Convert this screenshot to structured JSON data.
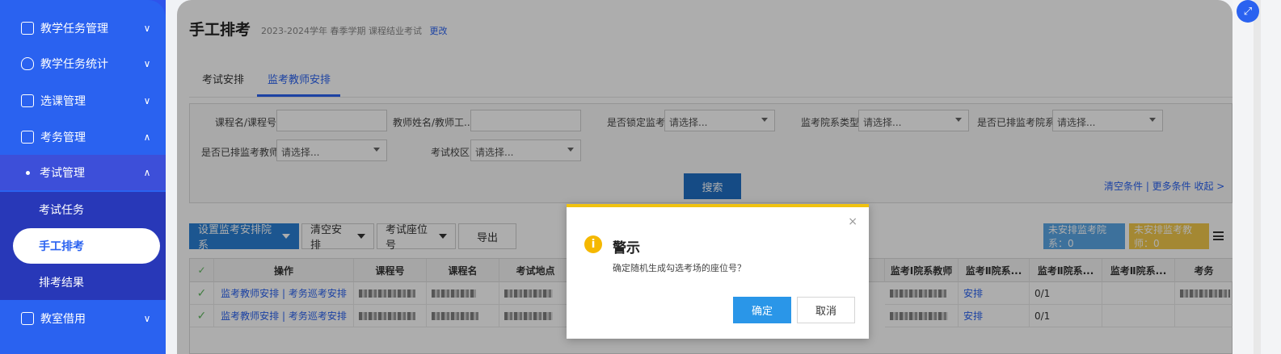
{
  "sidebar": {
    "items": [
      {
        "label": "教学任务管理",
        "icon": "document-icon",
        "state": "collapsed"
      },
      {
        "label": "教学任务统计",
        "icon": "shield-icon",
        "state": "collapsed"
      },
      {
        "label": "选课管理",
        "icon": "edit-doc-icon",
        "state": "collapsed"
      },
      {
        "label": "考务管理",
        "icon": "monitor-icon",
        "state": "expanded"
      },
      {
        "label": "考试管理",
        "state": "expanded"
      },
      {
        "label": "考试任务"
      },
      {
        "label": "手工排考",
        "active": true
      },
      {
        "label": "排考结果"
      },
      {
        "label": "教室借用",
        "icon": "book-icon",
        "state": "collapsed"
      }
    ],
    "chev_down": "∨",
    "chev_up": "∧"
  },
  "page": {
    "title": "手工排考",
    "subtitle": "2023-2024学年 春季学期 课程结业考试",
    "change_link": "更改"
  },
  "tabs": [
    {
      "label": "考试安排"
    },
    {
      "label": "监考教师安排",
      "active": true
    }
  ],
  "filters": {
    "course_label": "课程名/课程号",
    "teacher_label": "教师姓名/教师工...",
    "locked_label": "是否锁定监考",
    "dept_type_label": "监考院系类型",
    "dept_arranged_label": "是否已排监考院系",
    "teacher_arranged_label": "是否已排监考教师",
    "campus_label": "考试校区",
    "select_placeholder": "请选择...",
    "search_btn": "搜索",
    "links": "清空条件 | 更多条件   收起 >"
  },
  "toolbar": {
    "set_dept": "设置监考安排院系",
    "clear": "清空安排",
    "seat": "考试座位号",
    "export": "导出",
    "badge_dept": "未安排监考院系：0",
    "badge_teacher": "未安排监考教师：0",
    "badge_dept_color": "#5aa7e6",
    "badge_teacher_color": "#f2c94c"
  },
  "table": {
    "headers": [
      "✓",
      "操作",
      "课程号",
      "课程名",
      "考试地点",
      "监考Ⅰ院系教师",
      "监考Ⅱ院系...",
      "监考Ⅱ院系...",
      "监考Ⅱ院系...",
      "考务"
    ],
    "rows": [
      {
        "check": "✓",
        "action": "监考教师安排 | 考务巡考安排",
        "arrange": "安排",
        "ratio": "0/1"
      },
      {
        "check": "✓",
        "action": "监考教师安排 | 考务巡考安排",
        "arrange": "安排",
        "ratio": "0/1"
      }
    ]
  },
  "dialog": {
    "close": "×",
    "icon": "i",
    "title": "警示",
    "message": "确定随机生成勾选考场的座位号？",
    "ok": "确定",
    "cancel": "取消",
    "accent": "#f0c20f"
  },
  "fullscreen_icon": "⤢"
}
